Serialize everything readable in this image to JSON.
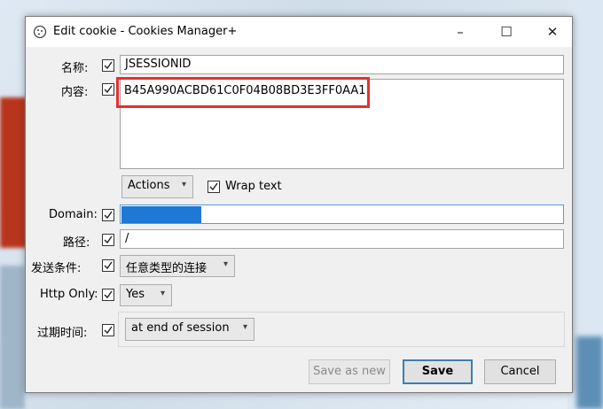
{
  "window": {
    "title": "Edit cookie - Cookies Manager+",
    "minimize": "–",
    "maximize": "☐",
    "close": "✕"
  },
  "fields": {
    "name_label": "名称:",
    "name_value": "JSESSIONID",
    "content_label": "内容:",
    "content_value": "B45A990ACBD61C0F04B08BD3E3FF0AA1",
    "domain_label": "Domain:",
    "path_label": "路径:",
    "path_value": "/",
    "send_label": "发送条件:",
    "send_value": "任意类型的连接",
    "httponly_label": "Http Only:",
    "httponly_value": "Yes",
    "expire_label": "过期时间:",
    "expire_value": "at end of session"
  },
  "actions": {
    "actions_label": "Actions",
    "wrap_text_label": "Wrap text"
  },
  "buttons": {
    "save_as_new": "Save as new",
    "save": "Save",
    "cancel": "Cancel"
  },
  "colors": {
    "highlight": "#e53030",
    "focus_border": "#5a9ad6",
    "domain_selection": "#1e78d6"
  }
}
